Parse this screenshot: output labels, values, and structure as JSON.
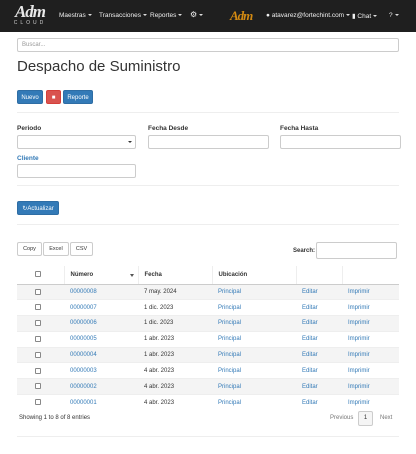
{
  "navbar": {
    "logo_text": "Adm",
    "logo_sub": "CLOUD",
    "menus": [
      "Maestras",
      "Transacciones",
      "Reportes"
    ],
    "center_logo": "Adm",
    "user_email": "atavarez@fortechint.com",
    "chat_label": "Chat"
  },
  "search": {
    "placeholder": "Buscar..."
  },
  "page_title": "Despacho de Suministro",
  "toolbar": {
    "new_label": "Nuevo",
    "report_label": "Reporte"
  },
  "filters": {
    "periodo_label": "Periodo",
    "fecha_desde_label": "Fecha Desde",
    "fecha_hasta_label": "Fecha Hasta",
    "cliente_label": "Cliente",
    "update_label": "Actualizar"
  },
  "export": {
    "copy": "Copy",
    "excel": "Excel",
    "csv": "CSV",
    "search_label": "Search:"
  },
  "table": {
    "headers": [
      "Número",
      "Fecha",
      "Ubicación"
    ],
    "rows": [
      {
        "numero": "00000008",
        "fecha": "7 may. 2024",
        "ubicacion": "Principal",
        "edit": "Editar",
        "print": "Imprimir"
      },
      {
        "numero": "00000007",
        "fecha": "1 dic. 2023",
        "ubicacion": "Principal",
        "edit": "Editar",
        "print": "Imprimir"
      },
      {
        "numero": "00000006",
        "fecha": "1 dic. 2023",
        "ubicacion": "Principal",
        "edit": "Editar",
        "print": "Imprimir"
      },
      {
        "numero": "00000005",
        "fecha": "1 abr. 2023",
        "ubicacion": "Principal",
        "edit": "Editar",
        "print": "Imprimir"
      },
      {
        "numero": "00000004",
        "fecha": "1 abr. 2023",
        "ubicacion": "Principal",
        "edit": "Editar",
        "print": "Imprimir"
      },
      {
        "numero": "00000003",
        "fecha": "4 abr. 2023",
        "ubicacion": "Principal",
        "edit": "Editar",
        "print": "Imprimir"
      },
      {
        "numero": "00000002",
        "fecha": "4 abr. 2023",
        "ubicacion": "Principal",
        "edit": "Editar",
        "print": "Imprimir"
      },
      {
        "numero": "00000001",
        "fecha": "4 abr. 2023",
        "ubicacion": "Principal",
        "edit": "Editar",
        "print": "Imprimir"
      }
    ]
  },
  "footer": {
    "info": "Showing 1 to 8 of 8 entries",
    "previous": "Previous",
    "page": "1",
    "next": "Next"
  },
  "colors": {
    "primary": "#337ab7",
    "danger": "#d9534f",
    "navbar": "#1f1f1f",
    "brand_orange": "#d38a12"
  }
}
